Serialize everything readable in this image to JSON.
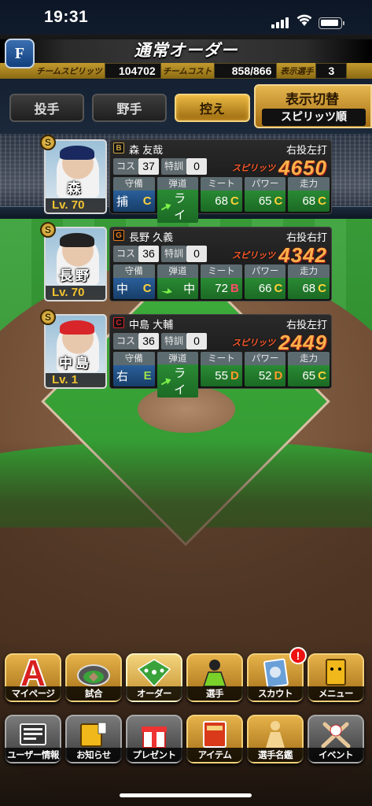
{
  "status_bar": {
    "time": "19:31"
  },
  "header": {
    "team_logo": "F",
    "title": "通常オーダー",
    "team_spirits_label": "チームスピリッツ",
    "team_spirits_value": "104702",
    "team_cost_label": "チームコスト",
    "team_cost_value": "858/866",
    "display_player_label": "表示選手",
    "display_player_value": "3"
  },
  "tabs": [
    {
      "label": "投手",
      "active": false
    },
    {
      "label": "野手",
      "active": false
    },
    {
      "label": "控え",
      "active": true
    }
  ],
  "sort": {
    "title": "表示切替",
    "value": "スピリッツ順"
  },
  "labels": {
    "cost": "コス",
    "training": "特訓",
    "spirits": "スピリッツ",
    "defense": "守備",
    "trajectory": "弾道",
    "meet": "ミート",
    "power": "パワー",
    "speed": "走力"
  },
  "players": [
    {
      "team_mark": "B",
      "team_color": "#c8a040",
      "name": "森 友哉",
      "photo_name": "森",
      "level": "Lv. 70",
      "hand": "右投左打",
      "cost": "37",
      "training": "0",
      "spirits": "4650",
      "position": "捕",
      "position_rank": "C",
      "trajectory": "ライ",
      "meet": "68",
      "meet_rank": "C",
      "power": "65",
      "power_rank": "C",
      "speed": "68",
      "speed_rank": "C"
    },
    {
      "team_mark": "G",
      "team_color": "#e87a1a",
      "name": "長野 久義",
      "photo_name": "長野",
      "level": "Lv. 70",
      "hand": "右投右打",
      "cost": "36",
      "training": "0",
      "spirits": "4342",
      "position": "中",
      "position_rank": "C",
      "trajectory": "中",
      "meet": "72",
      "meet_rank": "B",
      "power": "66",
      "power_rank": "C",
      "speed": "68",
      "speed_rank": "C"
    },
    {
      "team_mark": "C",
      "team_color": "#d8252a",
      "name": "中島 大輔",
      "photo_name": "中島",
      "level": "Lv. 1",
      "hand": "右投左打",
      "cost": "36",
      "training": "0",
      "spirits": "2449",
      "position": "右",
      "position_rank": "E",
      "trajectory": "ライ",
      "meet": "55",
      "meet_rank": "D",
      "power": "52",
      "power_rank": "D",
      "speed": "65",
      "speed_rank": "C"
    }
  ],
  "rank_colors": {
    "B": "#ff4d6a",
    "C": "#ffd23a",
    "D": "#ff9a2a",
    "E": "#9ee04a"
  },
  "menu_row1": [
    {
      "label": "マイページ",
      "icon": "mypage-a-icon"
    },
    {
      "label": "試合",
      "icon": "stadium-icon"
    },
    {
      "label": "オーダー",
      "icon": "field-order-icon"
    },
    {
      "label": "選手",
      "icon": "player-icon"
    },
    {
      "label": "スカウト",
      "icon": "scout-card-icon",
      "notice": "!"
    },
    {
      "label": "メニュー",
      "icon": "menu-character-icon"
    }
  ],
  "menu_row2": [
    {
      "label": "ユーザー情報",
      "icon": "user-info-icon"
    },
    {
      "label": "お知らせ",
      "icon": "notice-icon"
    },
    {
      "label": "プレゼント",
      "icon": "present-icon"
    },
    {
      "label": "アイテム",
      "icon": "item-book-icon"
    },
    {
      "label": "選手名鑑",
      "icon": "player-directory-icon"
    },
    {
      "label": "イベント",
      "icon": "event-bats-icon"
    }
  ]
}
